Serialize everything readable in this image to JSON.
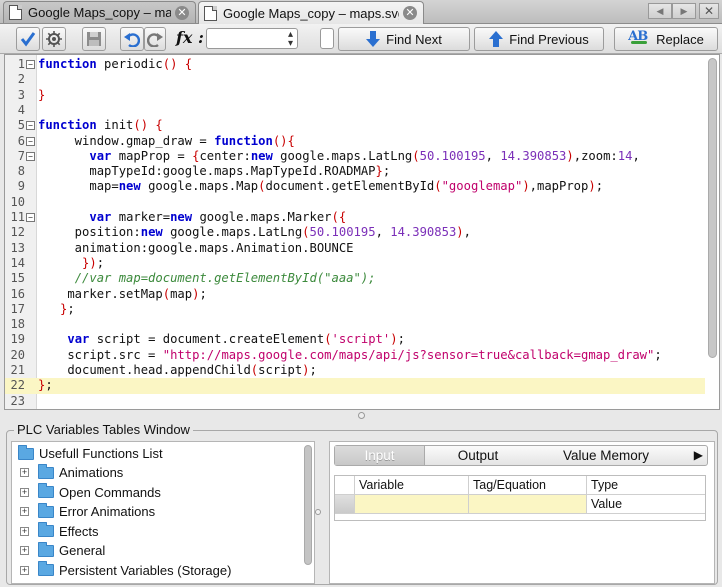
{
  "tabs": [
    {
      "title": "Google Maps_copy – maps",
      "close": "✕"
    },
    {
      "title": "Google Maps_copy – maps.svg.js",
      "close": "✕"
    }
  ],
  "window": {
    "close": "✕",
    "nav_left": "◀",
    "nav_right": "▶"
  },
  "toolbar": {
    "fx_label": "fx :",
    "find_next": "Find Next",
    "find_previous": "Find Previous",
    "replace": "Replace",
    "replace_badge": "AB"
  },
  "editor": {
    "highlighted_line": 22,
    "lines": [
      {
        "n": "1",
        "fold": "−",
        "code": "<span class='kw'>function</span> periodic<span class='red'>()</span> <span class='red'>{</span>"
      },
      {
        "n": "2",
        "fold": "",
        "code": ""
      },
      {
        "n": "3",
        "fold": "",
        "code": "<span class='red'>}</span>"
      },
      {
        "n": "4",
        "fold": "",
        "code": ""
      },
      {
        "n": "5",
        "fold": "−",
        "code": "<span class='kw'>function</span> init<span class='red'>()</span> <span class='red'>{</span>"
      },
      {
        "n": "6",
        "fold": "−",
        "code": "     window.gmap_draw = <span class='kw'>function</span><span class='red'>(){</span>"
      },
      {
        "n": "7",
        "fold": "−",
        "code": "       <span class='kw'>var</span> mapProp = <span class='red'>{</span>center:<span class='kw'>new</span> google.maps.LatLng<span class='red'>(</span><span class='num'>50.100195</span>, <span class='num'>14.390853</span><span class='red'>)</span>,zoom:<span class='num'>14</span>,"
      },
      {
        "n": "8",
        "fold": "",
        "code": "       mapTypeId:google.maps.MapTypeId.ROADMAP<span class='red'>}</span>;"
      },
      {
        "n": "9",
        "fold": "",
        "code": "       map=<span class='kw'>new</span> google.maps.Map<span class='red'>(</span>document.getElementById<span class='red'>(</span><span class='str'>\"googlemap\"</span><span class='red'>)</span>,mapProp<span class='red'>)</span>;"
      },
      {
        "n": "10",
        "fold": "",
        "code": ""
      },
      {
        "n": "11",
        "fold": "−",
        "code": "       <span class='kw'>var</span> marker=<span class='kw'>new</span> google.maps.Marker<span class='red'>({</span>"
      },
      {
        "n": "12",
        "fold": "",
        "code": "     position:<span class='kw'>new</span> google.maps.LatLng<span class='red'>(</span><span class='num'>50.100195</span>, <span class='num'>14.390853</span><span class='red'>)</span>,"
      },
      {
        "n": "13",
        "fold": "",
        "code": "     animation:google.maps.Animation.BOUNCE"
      },
      {
        "n": "14",
        "fold": "",
        "code": "      <span class='red'>})</span>;"
      },
      {
        "n": "15",
        "fold": "",
        "code": "     <span class='cm'>//var map=document.getElementById(\"aaa\");</span>"
      },
      {
        "n": "16",
        "fold": "",
        "code": "    marker.setMap<span class='red'>(</span>map<span class='red'>)</span>;"
      },
      {
        "n": "17",
        "fold": "",
        "code": "   <span class='red'>}</span>;"
      },
      {
        "n": "18",
        "fold": "",
        "code": ""
      },
      {
        "n": "19",
        "fold": "",
        "code": "    <span class='kw'>var</span> script = document.createElement<span class='red'>(</span><span class='str'>'script'</span><span class='red'>)</span>;"
      },
      {
        "n": "20",
        "fold": "",
        "code": "    script.src = <span class='str'>\"http://maps.google.com/maps/api/js?sensor=true&amp;callback=gmap_draw\"</span>;"
      },
      {
        "n": "21",
        "fold": "",
        "code": "    document.head.appendChild<span class='red'>(</span>script<span class='red'>)</span>;"
      },
      {
        "n": "22",
        "fold": "",
        "code": "<span class='red'>}</span>;"
      },
      {
        "n": "23",
        "fold": "",
        "code": ""
      }
    ]
  },
  "panel": {
    "title": "PLC Variables Tables Window",
    "tree_root": "Usefull Functions List",
    "tree_items": [
      "Animations",
      "Open Commands",
      "Error Animations",
      "Effects",
      "General",
      "Persistent Variables (Storage)"
    ],
    "expand_glyph": "+",
    "tabs": [
      "Input",
      "Output",
      "Value Memory"
    ],
    "tabs_more": "▶",
    "columns": [
      "Variable",
      "Tag/Equation",
      "Type"
    ],
    "row": {
      "variable": "",
      "tag": "",
      "type": "Value"
    }
  }
}
